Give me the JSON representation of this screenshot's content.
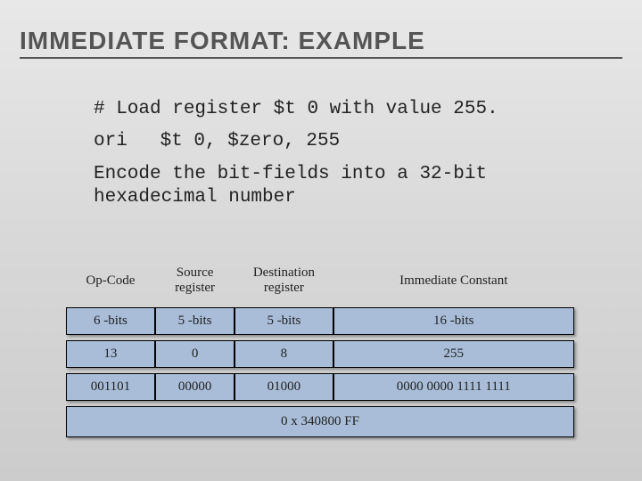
{
  "title": "IMMEDIATE FORMAT: EXAMPLE",
  "body": {
    "comment": "# Load register $t 0 with value 255.",
    "instr_mnemonic": "ori",
    "instr_operands": "$t 0, $zero, 255",
    "prompt": "Encode the bit-fields into a 32-bit hexadecimal number"
  },
  "table": {
    "headers": {
      "opcode": "Op-Code",
      "src": "Source register",
      "dst": "Destination register",
      "imm": "Immediate Constant"
    },
    "widths": {
      "opcode": "6 -bits",
      "src": "5 -bits",
      "dst": "5 -bits",
      "imm": "16 -bits"
    },
    "decimal": {
      "opcode": "13",
      "src": "0",
      "dst": "8",
      "imm": "255"
    },
    "binary": {
      "opcode": "001101",
      "src": "00000",
      "dst": "01000",
      "imm": "0000 0000 1111 1111"
    },
    "hex": "0 x 340800 FF"
  }
}
